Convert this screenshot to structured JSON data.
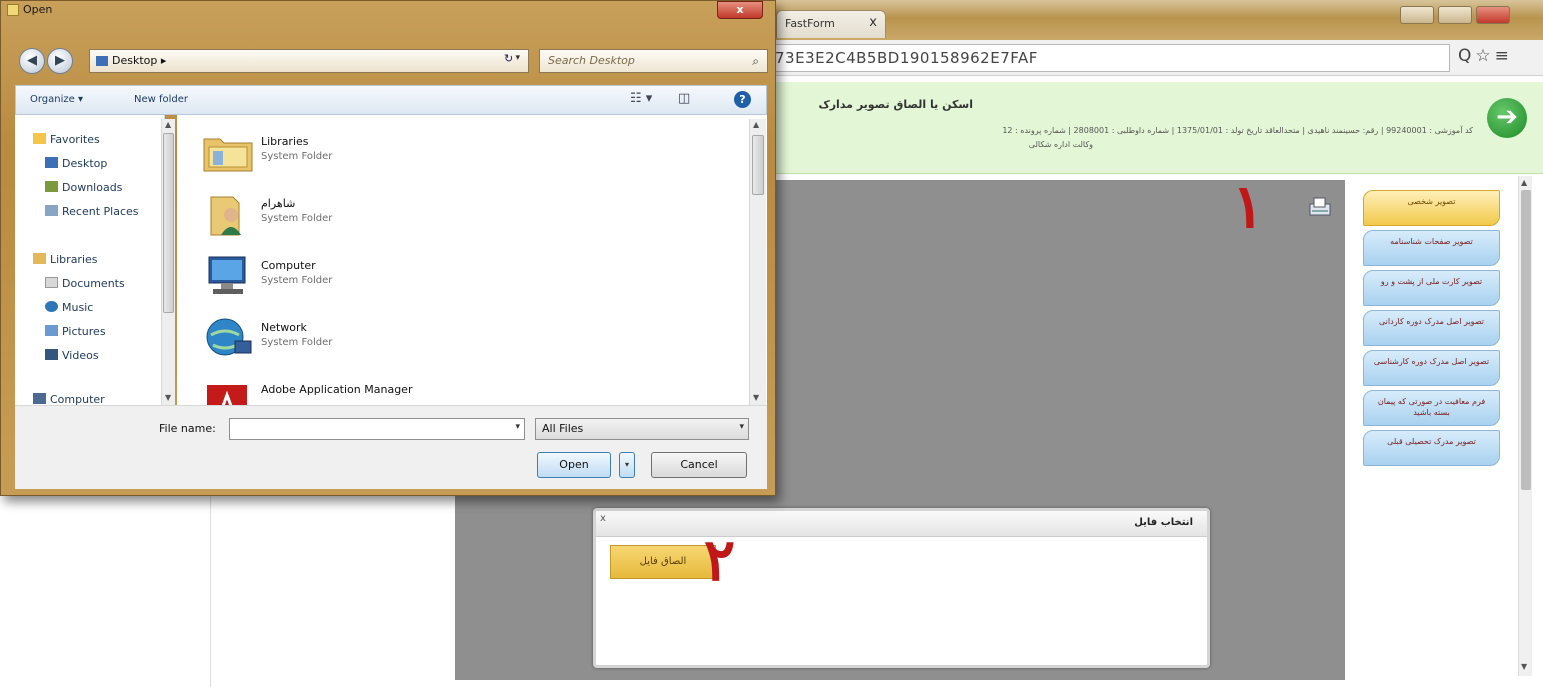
{
  "browser": {
    "tab_title": "FastForm",
    "tab_close": "x",
    "url_text": "73E3E2C4B5BD190158962E7FAF",
    "url_icons": "Q☆≡"
  },
  "banner": {
    "title": "اسکن یا الصاق تصویر مدارک",
    "info_line1": "کد آموزشی : 99240001 | رقم: حسینمند ناهیدی | متحدالعاقد تاریخ تولد : 1375/01/01 | شماره داوطلبی : 2808001 | شماره پرونده : 12",
    "info_line2": "وکالت اداره شکالی",
    "next_arrow": "➔"
  },
  "side_menu": {
    "items": [
      "تصویر شخصی",
      "تصویر صفحات شناسنامه",
      "تصویر کارت ملی از پشت و رو",
      "تصویر اصل مدرک دوره کاردانی",
      "تصویر اصل مدرک دوره کارشناسی",
      "فرم معافیت در صورتی که پیمان بسته باشید",
      "تصویر مدرک تحصیلی قبلی"
    ]
  },
  "annotations": {
    "one": "۱",
    "two": "۲"
  },
  "popup": {
    "title": "انتخاب فایل",
    "close": "x",
    "attach_button": "الصاق فایل"
  },
  "dialog": {
    "title": "Open",
    "close": "x",
    "back": "◀",
    "forward": "▶",
    "address": "Desktop ▸",
    "address_drop": "▾",
    "refresh": "↻",
    "search_placeholder": "Search Desktop",
    "search_icon": "⌕",
    "toolbar": {
      "organize": "Organize ▾",
      "new_folder": "New folder",
      "view": "☷ ▾",
      "pane": "◫",
      "help": "?"
    },
    "nav": {
      "favorites": "Favorites",
      "desktop": "Desktop",
      "downloads": "Downloads",
      "recent_places": "Recent Places",
      "libraries": "Libraries",
      "documents": "Documents",
      "music": "Music",
      "pictures": "Pictures",
      "videos": "Videos",
      "computer": "Computer"
    },
    "files": [
      {
        "name": "Libraries",
        "type": "System Folder"
      },
      {
        "name": "شاهرام",
        "type": "System Folder"
      },
      {
        "name": "Computer",
        "type": "System Folder"
      },
      {
        "name": "Network",
        "type": "System Folder"
      },
      {
        "name": "Adobe Application Manager",
        "type": ""
      }
    ],
    "file_name_label": "File name:",
    "file_name_value": "",
    "filter": "All Files",
    "open_button": "Open",
    "open_split": "▾",
    "cancel_button": "Cancel"
  },
  "icons": {
    "colors": {
      "accent_green": "#1e8a26",
      "menu_blue": "#a9d1ef",
      "menu_active": "#f2c94c",
      "annotation_red": "#c01818",
      "dialog_frame": "#c8a05a"
    }
  }
}
